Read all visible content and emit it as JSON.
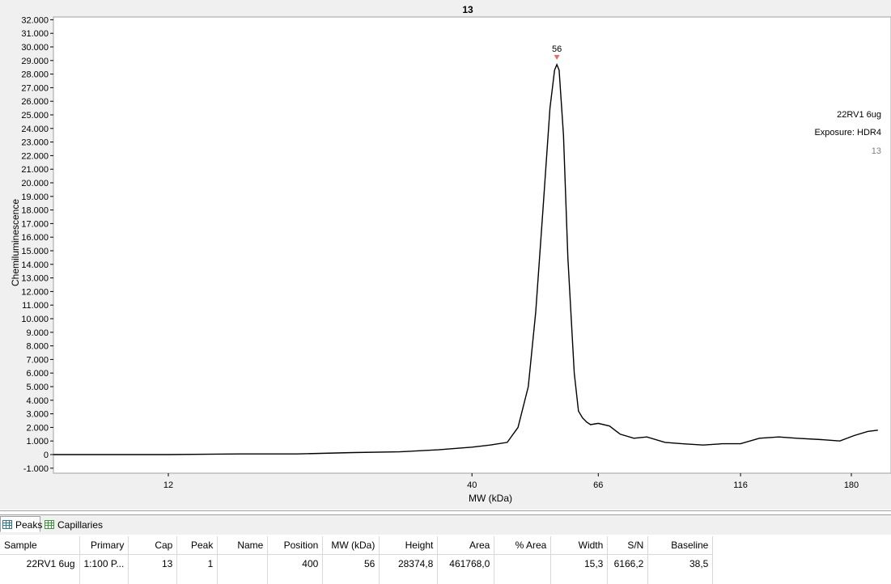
{
  "chart_data": {
    "type": "line",
    "title": "13",
    "xlabel": "MW (kDa)",
    "ylabel": "Chemiluminescence",
    "ylim": [
      -1000,
      32000
    ],
    "yticks": [
      -1000,
      0,
      1000,
      2000,
      3000,
      4000,
      5000,
      6000,
      7000,
      8000,
      9000,
      10000,
      11000,
      12000,
      13000,
      14000,
      15000,
      16000,
      17000,
      18000,
      19000,
      20000,
      21000,
      22000,
      23000,
      24000,
      25000,
      26000,
      27000,
      28000,
      29000,
      30000,
      31000,
      32000
    ],
    "ytick_labels": [
      "-1.000",
      "0",
      "1.000",
      "2.000",
      "3.000",
      "4.000",
      "5.000",
      "6.000",
      "7.000",
      "8.000",
      "9.000",
      "10.000",
      "11.000",
      "12.000",
      "13.000",
      "14.000",
      "15.000",
      "16.000",
      "17.000",
      "18.000",
      "19.000",
      "20.000",
      "21.000",
      "22.000",
      "23.000",
      "24.000",
      "25.000",
      "26.000",
      "27.000",
      "28.000",
      "29.000",
      "30.000",
      "31.000",
      "32.000"
    ],
    "x_scale": "log",
    "xlim": [
      7,
      200
    ],
    "xticks": [
      12,
      40,
      66,
      116,
      180
    ],
    "xtick_labels": [
      "12",
      "40",
      "66",
      "116",
      "180"
    ],
    "grid": false,
    "series": [
      {
        "x": [
          7,
          9,
          12,
          16,
          20,
          25,
          30,
          35,
          40,
          43,
          46,
          48,
          50,
          51.5,
          53,
          54.5,
          55.5,
          56,
          56.5,
          57.5,
          58.5,
          60,
          61,
          62,
          63,
          64,
          66,
          69,
          72,
          76,
          80,
          86,
          92,
          100,
          108,
          116,
          125,
          135,
          145,
          160,
          172,
          182,
          192,
          200
        ],
        "y": [
          0,
          0,
          0,
          50,
          50,
          150,
          200,
          350,
          550,
          700,
          900,
          2000,
          5000,
          10500,
          18000,
          25500,
          28300,
          28700,
          28300,
          23500,
          14500,
          6000,
          3200,
          2700,
          2400,
          2200,
          2300,
          2100,
          1500,
          1200,
          1300,
          900,
          800,
          700,
          800,
          800,
          1200,
          1300,
          1200,
          1100,
          1000,
          1400,
          1700,
          1800
        ]
      }
    ],
    "peak_marker": {
      "x": 56,
      "y": 28700,
      "label": "56"
    },
    "legend_lines": [
      "22RV1 6ug",
      "Exposure: HDR4",
      "13"
    ],
    "legend_colors": [
      "#000000",
      "#000000",
      "#808080"
    ],
    "legend_position": "top-right",
    "line_color": "#000000",
    "marker_color": "#e36c6c"
  },
  "tabs": [
    {
      "label": "Peaks",
      "icon": "grid-icon",
      "active": true
    },
    {
      "label": "Capillaries",
      "icon": "grid-icon",
      "active": false
    }
  ],
  "table": {
    "columns": [
      "Sample",
      "Primary",
      "Cap",
      "Peak",
      "Name",
      "Position",
      "MW (kDa)",
      "Height",
      "Area",
      "% Area",
      "Width",
      "S/N",
      "Baseline"
    ],
    "rows": [
      [
        "22RV1 6ug",
        "1:100 P...",
        "13",
        "1",
        "",
        "400",
        "56",
        "28374,8",
        "461768,0",
        "",
        "15,3",
        "6166,2",
        "38,5"
      ]
    ]
  }
}
